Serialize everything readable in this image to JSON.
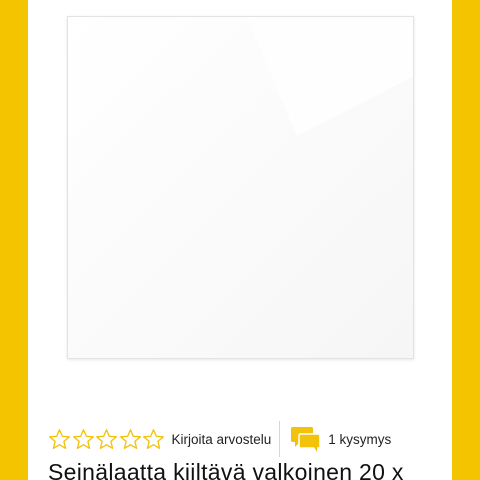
{
  "theme": {
    "accent_color": "#f5c400",
    "star_color": "#f3c20b",
    "qa_icon_color": "#f3c20b"
  },
  "product": {
    "image_icon": "white-glossy-tile",
    "rating": {
      "stars_filled": 0,
      "stars_total": 5,
      "write_review_label": "Kirjoita arvostelu"
    },
    "questions": {
      "icon": "speech-bubbles-icon",
      "label": "1 kysymys"
    },
    "title": "Seinälaatta kiiltävä valkoinen 20 x"
  }
}
